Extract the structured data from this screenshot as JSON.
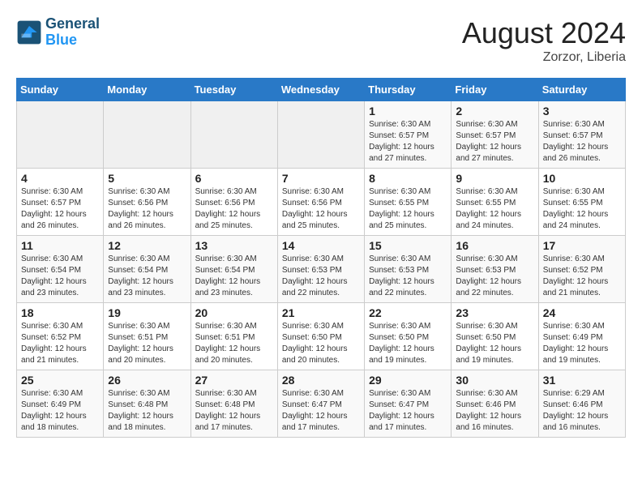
{
  "header": {
    "logo_line1": "General",
    "logo_line2": "Blue",
    "month": "August 2024",
    "location": "Zorzor, Liberia"
  },
  "weekdays": [
    "Sunday",
    "Monday",
    "Tuesday",
    "Wednesday",
    "Thursday",
    "Friday",
    "Saturday"
  ],
  "weeks": [
    [
      {
        "day": "",
        "empty": true
      },
      {
        "day": "",
        "empty": true
      },
      {
        "day": "",
        "empty": true
      },
      {
        "day": "",
        "empty": true
      },
      {
        "day": "1",
        "sunrise": "6:30 AM",
        "sunset": "6:57 PM",
        "daylight": "12 hours and 27 minutes."
      },
      {
        "day": "2",
        "sunrise": "6:30 AM",
        "sunset": "6:57 PM",
        "daylight": "12 hours and 27 minutes."
      },
      {
        "day": "3",
        "sunrise": "6:30 AM",
        "sunset": "6:57 PM",
        "daylight": "12 hours and 26 minutes."
      }
    ],
    [
      {
        "day": "4",
        "sunrise": "6:30 AM",
        "sunset": "6:57 PM",
        "daylight": "12 hours and 26 minutes."
      },
      {
        "day": "5",
        "sunrise": "6:30 AM",
        "sunset": "6:56 PM",
        "daylight": "12 hours and 26 minutes."
      },
      {
        "day": "6",
        "sunrise": "6:30 AM",
        "sunset": "6:56 PM",
        "daylight": "12 hours and 25 minutes."
      },
      {
        "day": "7",
        "sunrise": "6:30 AM",
        "sunset": "6:56 PM",
        "daylight": "12 hours and 25 minutes."
      },
      {
        "day": "8",
        "sunrise": "6:30 AM",
        "sunset": "6:55 PM",
        "daylight": "12 hours and 25 minutes."
      },
      {
        "day": "9",
        "sunrise": "6:30 AM",
        "sunset": "6:55 PM",
        "daylight": "12 hours and 24 minutes."
      },
      {
        "day": "10",
        "sunrise": "6:30 AM",
        "sunset": "6:55 PM",
        "daylight": "12 hours and 24 minutes."
      }
    ],
    [
      {
        "day": "11",
        "sunrise": "6:30 AM",
        "sunset": "6:54 PM",
        "daylight": "12 hours and 23 minutes."
      },
      {
        "day": "12",
        "sunrise": "6:30 AM",
        "sunset": "6:54 PM",
        "daylight": "12 hours and 23 minutes."
      },
      {
        "day": "13",
        "sunrise": "6:30 AM",
        "sunset": "6:54 PM",
        "daylight": "12 hours and 23 minutes."
      },
      {
        "day": "14",
        "sunrise": "6:30 AM",
        "sunset": "6:53 PM",
        "daylight": "12 hours and 22 minutes."
      },
      {
        "day": "15",
        "sunrise": "6:30 AM",
        "sunset": "6:53 PM",
        "daylight": "12 hours and 22 minutes."
      },
      {
        "day": "16",
        "sunrise": "6:30 AM",
        "sunset": "6:53 PM",
        "daylight": "12 hours and 22 minutes."
      },
      {
        "day": "17",
        "sunrise": "6:30 AM",
        "sunset": "6:52 PM",
        "daylight": "12 hours and 21 minutes."
      }
    ],
    [
      {
        "day": "18",
        "sunrise": "6:30 AM",
        "sunset": "6:52 PM",
        "daylight": "12 hours and 21 minutes."
      },
      {
        "day": "19",
        "sunrise": "6:30 AM",
        "sunset": "6:51 PM",
        "daylight": "12 hours and 20 minutes."
      },
      {
        "day": "20",
        "sunrise": "6:30 AM",
        "sunset": "6:51 PM",
        "daylight": "12 hours and 20 minutes."
      },
      {
        "day": "21",
        "sunrise": "6:30 AM",
        "sunset": "6:50 PM",
        "daylight": "12 hours and 20 minutes."
      },
      {
        "day": "22",
        "sunrise": "6:30 AM",
        "sunset": "6:50 PM",
        "daylight": "12 hours and 19 minutes."
      },
      {
        "day": "23",
        "sunrise": "6:30 AM",
        "sunset": "6:50 PM",
        "daylight": "12 hours and 19 minutes."
      },
      {
        "day": "24",
        "sunrise": "6:30 AM",
        "sunset": "6:49 PM",
        "daylight": "12 hours and 19 minutes."
      }
    ],
    [
      {
        "day": "25",
        "sunrise": "6:30 AM",
        "sunset": "6:49 PM",
        "daylight": "12 hours and 18 minutes."
      },
      {
        "day": "26",
        "sunrise": "6:30 AM",
        "sunset": "6:48 PM",
        "daylight": "12 hours and 18 minutes."
      },
      {
        "day": "27",
        "sunrise": "6:30 AM",
        "sunset": "6:48 PM",
        "daylight": "12 hours and 17 minutes."
      },
      {
        "day": "28",
        "sunrise": "6:30 AM",
        "sunset": "6:47 PM",
        "daylight": "12 hours and 17 minutes."
      },
      {
        "day": "29",
        "sunrise": "6:30 AM",
        "sunset": "6:47 PM",
        "daylight": "12 hours and 17 minutes."
      },
      {
        "day": "30",
        "sunrise": "6:30 AM",
        "sunset": "6:46 PM",
        "daylight": "12 hours and 16 minutes."
      },
      {
        "day": "31",
        "sunrise": "6:29 AM",
        "sunset": "6:46 PM",
        "daylight": "12 hours and 16 minutes."
      }
    ]
  ]
}
